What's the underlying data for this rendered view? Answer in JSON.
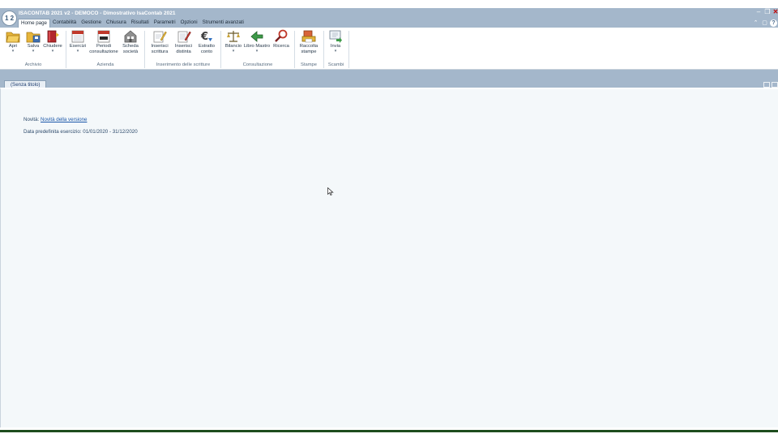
{
  "window": {
    "title": "ISACONTAB 2021 v2 - DEMOCO - Dimostrativo IsaContab 2021",
    "logo_text": "1 2 3"
  },
  "menu": {
    "tabs": [
      "Home page",
      "Contabilità",
      "Gestione",
      "Chiusura",
      "Risultati",
      "Parametri",
      "Opzioni",
      "Strumenti avanzati"
    ],
    "active_tab": "Home page"
  },
  "ribbon": {
    "groups": {
      "archivio": "Archivio",
      "azienda": "Azienda",
      "inserimento": "Inserimento delle scritture",
      "consultazione": "Consultazione",
      "stampe": "Stampe",
      "scambi": "Scambi"
    },
    "buttons": {
      "apri": "Apri",
      "salva": "Salva",
      "chiudere": "Chiudere",
      "esercizi": "Esercizi",
      "periodi_1": "Periodi",
      "periodi_2": "consultazione",
      "scheda_1": "Scheda",
      "scheda_2": "società",
      "inserisci_scrittura_1": "Inserisci",
      "inserisci_scrittura_2": "scrittura",
      "inserisci_distinta_1": "Inserisci",
      "inserisci_distinta_2": "distinta",
      "estratto_1": "Estratto",
      "estratto_2": "conto",
      "bilancio": "Bilancio",
      "libro_mastro": "Libro Mastro",
      "ricerca": "Ricerca",
      "raccolta_1": "Raccolta",
      "raccolta_2": "stampe",
      "invia": "Invia"
    },
    "icons": {
      "apri": "open-folder-icon",
      "salva": "save-folder-icon",
      "chiudere": "close-book-icon",
      "esercizi": "calendar-icon",
      "periodi": "calendar-year-icon",
      "scheda": "company-building-icon",
      "inserisci_scrittura": "edit-entry-icon",
      "inserisci_distinta": "edit-list-icon",
      "estratto": "euro-statement-icon",
      "bilancio": "balance-scale-icon",
      "libro_mastro": "ledger-arrow-icon",
      "ricerca": "magnifier-icon",
      "raccolta": "print-collection-icon",
      "invia": "send-icon"
    }
  },
  "document_tab": {
    "label": "(Senza titolo)"
  },
  "home": {
    "novita_label": "Novità:",
    "novita_link": "Novità della versione",
    "data_eser_text": "Data predefinita esercizio: 01/01/2020 - 31/12/2020"
  },
  "colors": {
    "titlebar": "#a4b7cb",
    "content_bg": "#f4f8fa",
    "link": "#1a56a8",
    "status_bar": "#1e4d1e"
  }
}
